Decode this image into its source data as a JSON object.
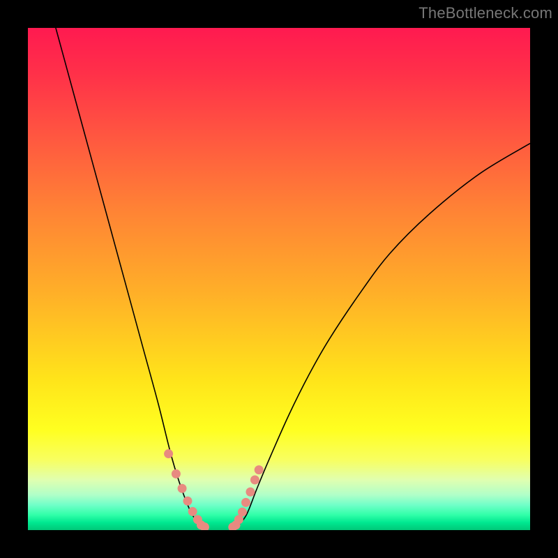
{
  "watermark": "TheBottleneck.com",
  "chart_data": {
    "type": "line",
    "title": "",
    "xlabel": "",
    "ylabel": "",
    "series": [
      {
        "name": "left-curve",
        "x": [
          0.05,
          0.08,
          0.11,
          0.14,
          0.17,
          0.2,
          0.23,
          0.26,
          0.285,
          0.305,
          0.325,
          0.345
        ],
        "y": [
          1.02,
          0.91,
          0.8,
          0.69,
          0.58,
          0.47,
          0.36,
          0.25,
          0.15,
          0.085,
          0.035,
          0.005
        ]
      },
      {
        "name": "right-curve",
        "x": [
          0.415,
          0.435,
          0.455,
          0.48,
          0.52,
          0.56,
          0.6,
          0.66,
          0.72,
          0.8,
          0.9,
          1.0
        ],
        "y": [
          0.005,
          0.03,
          0.08,
          0.14,
          0.23,
          0.31,
          0.38,
          0.47,
          0.55,
          0.63,
          0.71,
          0.77
        ]
      },
      {
        "name": "floor",
        "x": [
          0.345,
          0.415
        ],
        "y": [
          0.005,
          0.005
        ]
      }
    ],
    "beads_left": [
      [
        0.28,
        0.152
      ],
      [
        0.295,
        0.112
      ],
      [
        0.307,
        0.083
      ],
      [
        0.318,
        0.058
      ],
      [
        0.328,
        0.037
      ],
      [
        0.338,
        0.021
      ],
      [
        0.345,
        0.01
      ],
      [
        0.352,
        0.006
      ]
    ],
    "beads_right": [
      [
        0.408,
        0.006
      ],
      [
        0.414,
        0.01
      ],
      [
        0.42,
        0.021
      ],
      [
        0.427,
        0.036
      ],
      [
        0.434,
        0.055
      ],
      [
        0.443,
        0.076
      ],
      [
        0.452,
        0.1
      ],
      [
        0.46,
        0.12
      ]
    ],
    "ylim": [
      0,
      1
    ],
    "grid": false,
    "legend": false,
    "background": "vertical-rainbow-heat"
  }
}
